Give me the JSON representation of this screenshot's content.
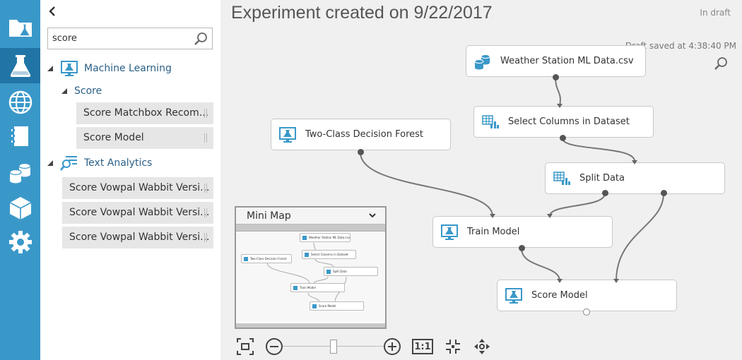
{
  "rail": {
    "items": [
      {
        "name": "experiments",
        "icon": "folder-flask-icon",
        "active": false
      },
      {
        "name": "flask",
        "icon": "flask-icon",
        "active": true
      },
      {
        "name": "web-services",
        "icon": "globe-icon",
        "active": false
      },
      {
        "name": "notebooks",
        "icon": "notebook-icon",
        "active": false
      },
      {
        "name": "datasets",
        "icon": "database-icon",
        "active": false
      },
      {
        "name": "trained-models",
        "icon": "cube-icon",
        "active": false
      },
      {
        "name": "settings",
        "icon": "gear-icon",
        "active": false
      }
    ],
    "color": "#3a98c9",
    "active_color": "#2175a6"
  },
  "palette": {
    "search": {
      "value": "score",
      "placeholder": ""
    },
    "categories": [
      {
        "label": "Machine Learning",
        "icon": "monitor-flask-icon",
        "subcategories": [
          {
            "label": "Score",
            "items": [
              "Score Matchbox Recom...",
              "Score Model"
            ]
          }
        ]
      },
      {
        "label": "Text Analytics",
        "icon": "text-analytics-icon",
        "items": [
          "Score Vowpal Wabbit Versi...",
          "Score Vowpal Wabbit Versi...",
          "Score Vowpal Wabbit Versi..."
        ]
      }
    ]
  },
  "canvas": {
    "title": "Experiment created on 9/22/2017",
    "status": "In draft",
    "saved": "Draft saved at 4:38:40 PM",
    "nodes": [
      {
        "id": "weather",
        "label": "Weather Station ML Data.csv",
        "icon": "dataset-icon"
      },
      {
        "id": "select",
        "label": "Select Columns in Dataset",
        "icon": "table-icon"
      },
      {
        "id": "forest",
        "label": "Two-Class Decision Forest",
        "icon": "monitor-flask-icon"
      },
      {
        "id": "split",
        "label": "Split Data",
        "icon": "table-icon"
      },
      {
        "id": "train",
        "label": "Train Model",
        "icon": "monitor-flask-icon"
      },
      {
        "id": "score",
        "label": "Score Model",
        "icon": "monitor-flask-icon"
      }
    ]
  },
  "minimap": {
    "title": "Mini Map",
    "nodes": [
      "Weather Station ML Data.csv",
      "Select Columns in Dataset",
      "Two-Class Decision Forest",
      "Split Data",
      "Train Model",
      "Score Model"
    ]
  },
  "toolbar": {
    "actual_size_label": "1:1"
  }
}
